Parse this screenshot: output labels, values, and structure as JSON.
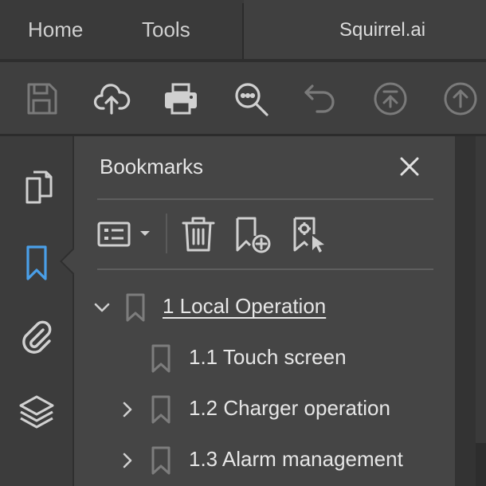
{
  "menubar": {
    "home_label": "Home",
    "tools_label": "Tools",
    "document_tab_title": "Squirrel.ai"
  },
  "toolbar": {
    "icons": [
      "save-icon",
      "upload-cloud-icon",
      "print-icon",
      "zoom-search-icon",
      "undo-icon",
      "scroll-top-icon",
      "page-up-icon"
    ]
  },
  "leftrail": {
    "icons": [
      "pages-icon",
      "bookmark-icon",
      "attachment-icon",
      "layers-icon"
    ],
    "active": "bookmark-icon"
  },
  "bookmarks_panel": {
    "title": "Bookmarks",
    "tools": [
      "options-menu-icon",
      "delete-icon",
      "add-bookmark-icon",
      "find-bookmark-icon"
    ],
    "items": [
      {
        "label": "1 Local Operation",
        "expanded": true,
        "selected": true
      },
      {
        "label": "1.1 Touch screen",
        "expanded": false,
        "has_children": false
      },
      {
        "label": "1.2 Charger operation",
        "expanded": false,
        "has_children": true
      },
      {
        "label": "1.3 Alarm management",
        "expanded": false,
        "has_children": true
      }
    ]
  },
  "colors": {
    "accent": "#4a9fe8",
    "background": "#3c3c3c",
    "panel": "#454545",
    "icon": "#d0d0d0",
    "icon_disabled": "#7a7a7a"
  }
}
